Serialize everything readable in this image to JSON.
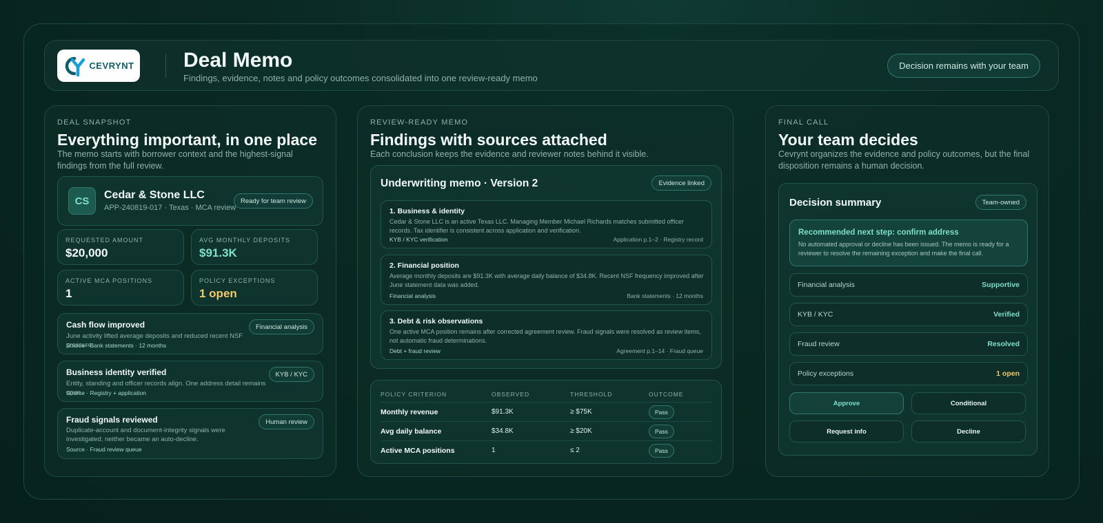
{
  "header": {
    "logo_text": "CEVRYNT",
    "title": "Deal Memo",
    "subtitle": "Findings, evidence, notes and policy outcomes consolidated into one review-ready memo",
    "pill": "Decision remains with your team"
  },
  "snapshot": {
    "eyebrow": "DEAL SNAPSHOT",
    "title": "Everything important, in one place",
    "desc": "The memo starts with borrower context and the highest-signal findings from the full review.",
    "company": {
      "initials": "CS",
      "name": "Cedar & Stone LLC",
      "sub": "APP-240819-017 · Texas · MCA review",
      "badge": "Ready for team review"
    },
    "stats": [
      {
        "label": "REQUESTED AMOUNT",
        "value": "$20,000"
      },
      {
        "label": "AVG MONTHLY DEPOSITS",
        "value": "$91.3K"
      },
      {
        "label": "ACTIVE MCA POSITIONS",
        "value": "1"
      },
      {
        "label": "POLICY EXCEPTIONS",
        "value": "1 open"
      }
    ],
    "findings": [
      {
        "title": "Cash flow improved",
        "badge": "Financial analysis",
        "text": "June activity lifted average deposits and reduced recent NSF pressure.",
        "source": "Source · Bank statements · 12 months"
      },
      {
        "title": "Business identity verified",
        "badge": "KYB / KYC",
        "text": "Entity, standing and officer records align. One address detail remains open.",
        "source": "Source · Registry + application"
      },
      {
        "title": "Fraud signals reviewed",
        "badge": "Human review",
        "text": "Duplicate-account and document-integrity signals were investigated; neither became an auto-decline.",
        "source": "Source · Fraud review queue"
      }
    ]
  },
  "memo": {
    "eyebrow": "REVIEW-READY MEMO",
    "title": "Findings with sources attached",
    "desc": "Each conclusion keeps the evidence and reviewer notes behind it visible.",
    "doc_title": "Underwriting memo · Version 2",
    "doc_badge": "Evidence linked",
    "sections": [
      {
        "title": "1. Business & identity",
        "text": "Cedar & Stone LLC is an active Texas LLC. Managing Member Michael Richards matches submitted officer records. Tax identifier is consistent across application and verification.",
        "left": "KYB / KYC verification",
        "right": "Application p.1–2 · Registry record"
      },
      {
        "title": "2. Financial position",
        "text": "Average monthly deposits are $91.3K with average daily balance of $34.8K. Recent NSF frequency improved after June statement data was added.",
        "left": "Financial analysis",
        "right": "Bank statements · 12 months"
      },
      {
        "title": "3. Debt & risk observations",
        "text": "One active MCA position remains after corrected agreement review. Fraud signals were resolved as review items, not automatic fraud determinations.",
        "left": "Debt + fraud review",
        "right": "Agreement p.1–14 · Fraud queue"
      }
    ],
    "policy": {
      "headers": [
        "POLICY CRITERION",
        "OBSERVED",
        "THRESHOLD",
        "OUTCOME"
      ],
      "rows": [
        {
          "criterion": "Monthly revenue",
          "observed": "$91.3K",
          "threshold": "≥ $75K",
          "outcome": "Pass"
        },
        {
          "criterion": "Avg daily balance",
          "observed": "$34.8K",
          "threshold": "≥ $20K",
          "outcome": "Pass"
        },
        {
          "criterion": "Active MCA positions",
          "observed": "1",
          "threshold": "≤ 2",
          "outcome": "Pass"
        }
      ]
    }
  },
  "final": {
    "eyebrow": "FINAL CALL",
    "title": "Your team decides",
    "desc": "Cevrynt organizes the evidence and policy outcomes, but the final disposition remains a human decision.",
    "summary_title": "Decision summary",
    "summary_badge": "Team-owned",
    "rec_title": "Recommended next step: confirm address",
    "rec_text": "No automated approval or decline has been issued. The memo is ready for a reviewer to resolve the remaining exception and make the final call.",
    "rows": [
      {
        "label": "Financial analysis",
        "value": "Supportive"
      },
      {
        "label": "KYB / KYC",
        "value": "Verified"
      },
      {
        "label": "Fraud review",
        "value": "Resolved"
      },
      {
        "label": "Policy exceptions",
        "value": "1 open"
      }
    ],
    "buttons": [
      "Approve",
      "Conditional",
      "Request info",
      "Decline"
    ]
  },
  "colors": {
    "accent": "#7ee0c8",
    "warning": "#f2c96b",
    "background": "#0a2823"
  }
}
